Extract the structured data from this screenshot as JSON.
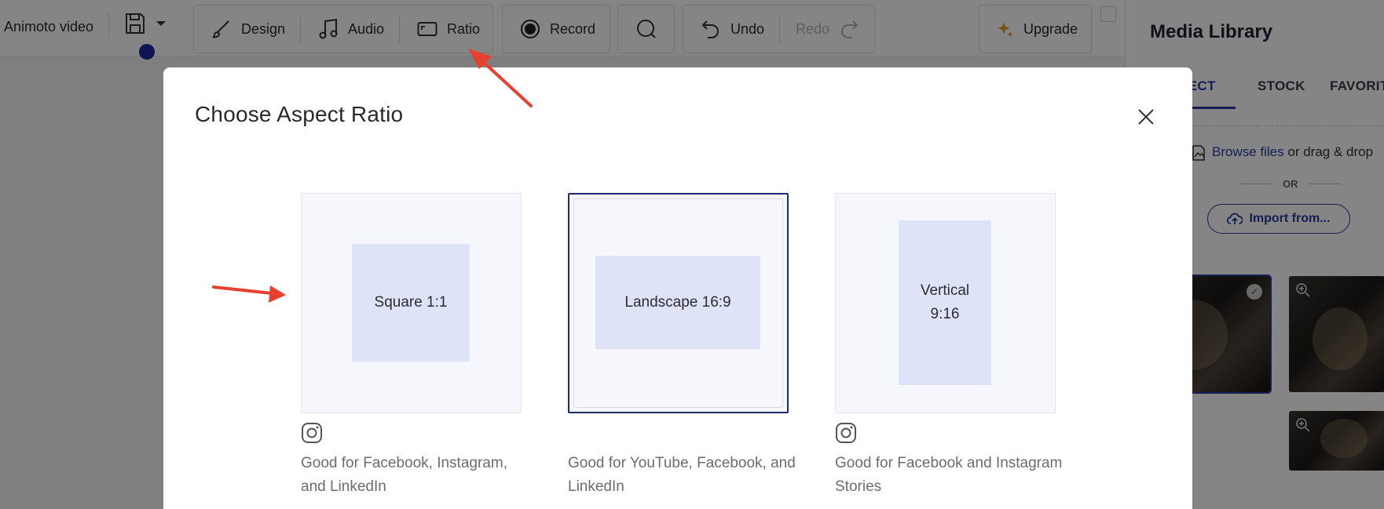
{
  "toolbar": {
    "project_title": "Animoto video",
    "design_label": "Design",
    "audio_label": "Audio",
    "ratio_label": "Ratio",
    "record_label": "Record",
    "undo_label": "Undo",
    "redo_label": "Redo",
    "upgrade_label": "Upgrade"
  },
  "media_library": {
    "title": "Media Library",
    "tabs": [
      {
        "label": "JECT",
        "active": true
      },
      {
        "label": "STOCK",
        "active": false
      },
      {
        "label": "FAVORIT",
        "active": false
      }
    ],
    "browse_link": "Browse files",
    "browse_suffix": " or drag & drop",
    "or_label": "OR",
    "import_label": "Import from..."
  },
  "modal": {
    "title": "Choose Aspect Ratio",
    "options": [
      {
        "label": "Square 1:1",
        "description": "Good for Facebook, Instagram, and LinkedIn",
        "instagram": true,
        "selected": false
      },
      {
        "label": "Landscape 16:9",
        "description": "Good for YouTube, Facebook, and LinkedIn",
        "instagram": false,
        "selected": true
      },
      {
        "label": "Vertical 9:16",
        "description": "Good for Facebook and Instagram Stories",
        "instagram": true,
        "selected": false
      }
    ]
  },
  "colors": {
    "accent": "#2a3a9e",
    "annotation_arrow": "#e8402f",
    "card_preview": "#dfe3f8",
    "selected_border": "#1f2b6e"
  }
}
